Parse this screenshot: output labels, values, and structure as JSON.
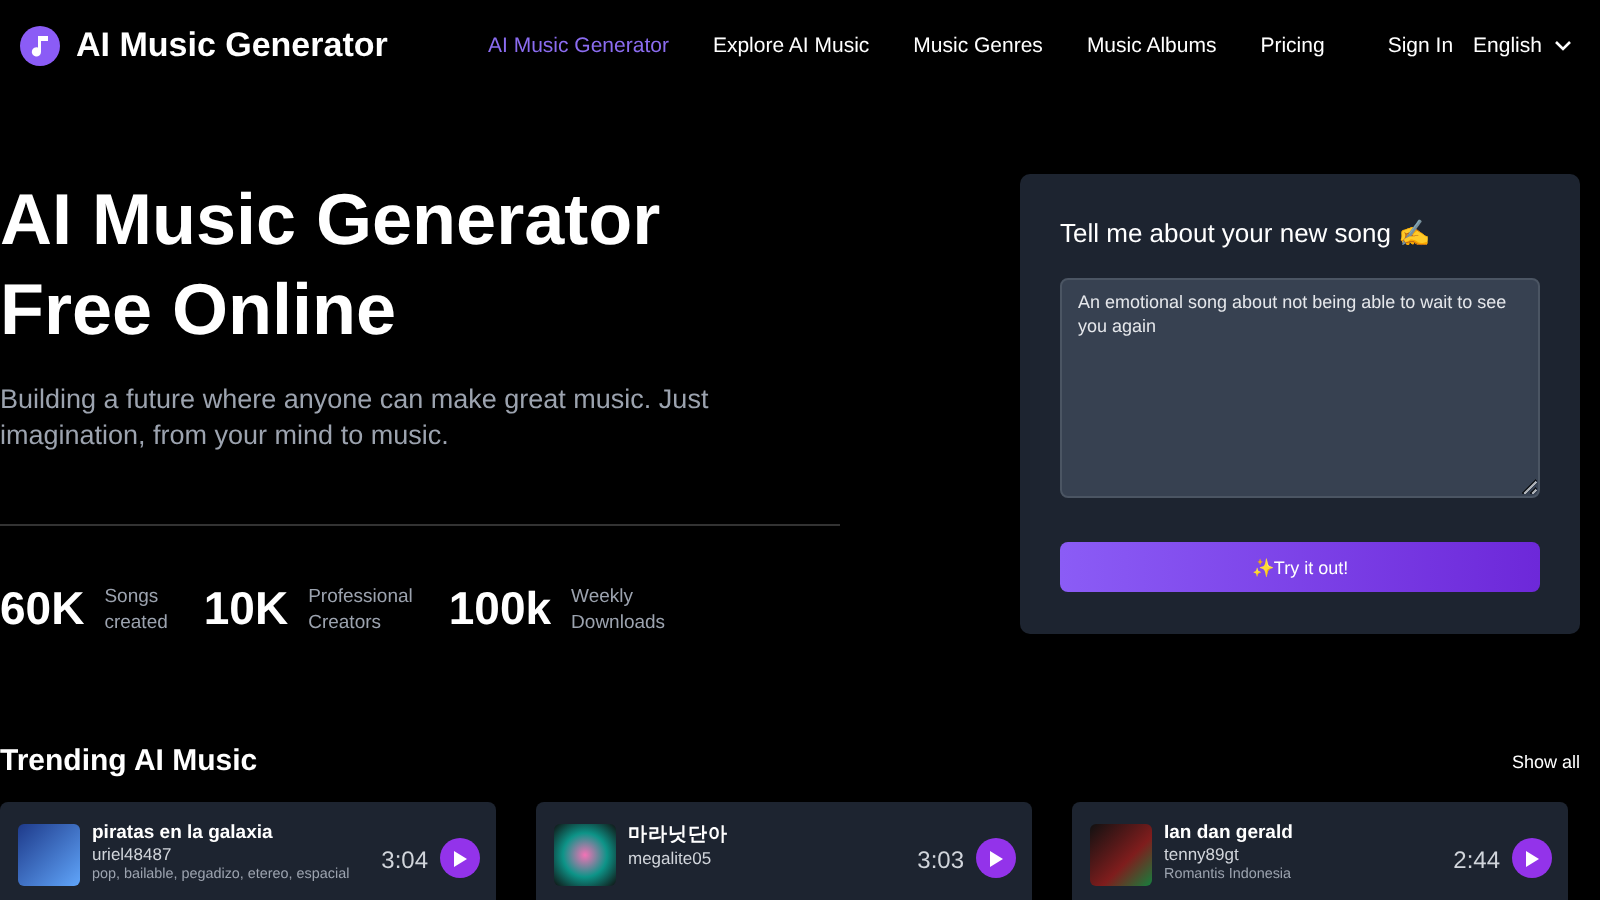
{
  "brand": {
    "name": "AI Music Generator"
  },
  "nav": [
    {
      "label": "AI Music Generator",
      "selected": true
    },
    {
      "label": "Explore AI Music",
      "selected": false
    },
    {
      "label": "Music Genres",
      "selected": false
    },
    {
      "label": "Music Albums",
      "selected": false
    },
    {
      "label": "Pricing",
      "selected": false
    }
  ],
  "account": {
    "sign_in": "Sign In",
    "language": "English"
  },
  "hero": {
    "title_lines": [
      "AI Music Generator",
      "Free Online"
    ],
    "subtitle": "Building a future where anyone can make great music. Just imagination, from your mind to music."
  },
  "stats": [
    {
      "value": "60K",
      "label_lines": [
        "Songs",
        "created"
      ]
    },
    {
      "value": "10K",
      "label_lines": [
        "Professional",
        "Creators"
      ]
    },
    {
      "value": "100k",
      "label_lines": [
        "Weekly",
        "Downloads"
      ]
    }
  ],
  "prompt_card": {
    "title": "Tell me about your new song ✍️",
    "value": "An emotional song about not being able to wait to see you again",
    "button": "✨Try it out!"
  },
  "trending": {
    "title": "Trending AI Music",
    "show_all": "Show all",
    "songs": [
      {
        "title": "piratas en la galaxia",
        "user": "uriel48487",
        "duration": "3:04",
        "tags": "pop, bailable, pegadizo, etereo, espacial"
      },
      {
        "title": "마라닛단아",
        "user": "megalite05",
        "duration": "3:03"
      },
      {
        "title": "Ian dan gerald",
        "user": "tenny89gt",
        "duration": "2:44",
        "tags": "Romantis Indonesia"
      }
    ]
  }
}
